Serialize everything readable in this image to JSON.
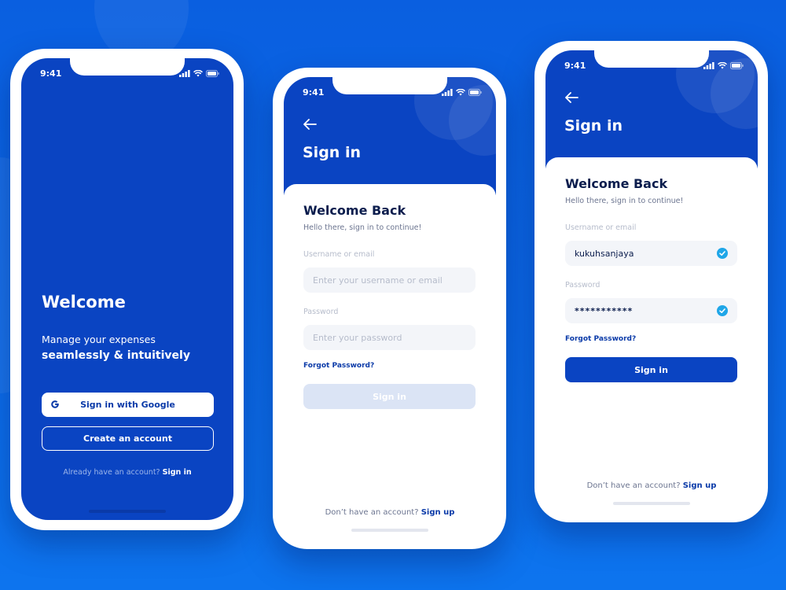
{
  "status_bar": {
    "time": "9:41"
  },
  "welcome_screen": {
    "title": "Welcome",
    "subtitle_line1": "Manage your expenses",
    "subtitle_line2": "seamlessly & intuitively",
    "google_button": "Sign in with Google",
    "create_account_button": "Create an account",
    "footer_prompt": "Already have an account?",
    "footer_link": "Sign in"
  },
  "signin_empty": {
    "title": "Sign in",
    "welcome_heading": "Welcome Back",
    "welcome_sub": "Hello there, sign in to continue!",
    "username_label": "Username or email",
    "username_placeholder": "Enter your username or email",
    "password_label": "Password",
    "password_placeholder": "Enter your password",
    "forgot_link": "Forgot Password?",
    "signin_button": "Sign in",
    "footer_prompt": "Don’t have an account?",
    "footer_link": "Sign up"
  },
  "signin_filled": {
    "title": "Sign in",
    "welcome_heading": "Welcome Back",
    "welcome_sub": "Hello there, sign in to continue!",
    "username_label": "Username or email",
    "username_value": "kukuhsanjaya",
    "password_label": "Password",
    "password_value": "***********",
    "forgot_link": "Forgot Password?",
    "signin_button": "Sign in",
    "footer_prompt": "Don’t have an account?",
    "footer_link": "Sign up"
  },
  "colors": {
    "background": "#0b66e6",
    "primary_blue": "#0a44c2",
    "link_blue": "#0a3aa8",
    "heading_navy": "#0b1d4d",
    "check_cyan": "#1fa6e8",
    "disabled_button": "#dbe4f5"
  },
  "icons": {
    "signal": "signal-icon",
    "wifi": "wifi-icon",
    "battery": "battery-icon",
    "back": "arrow-left-icon",
    "google": "google-icon",
    "check": "check-circle-icon"
  }
}
